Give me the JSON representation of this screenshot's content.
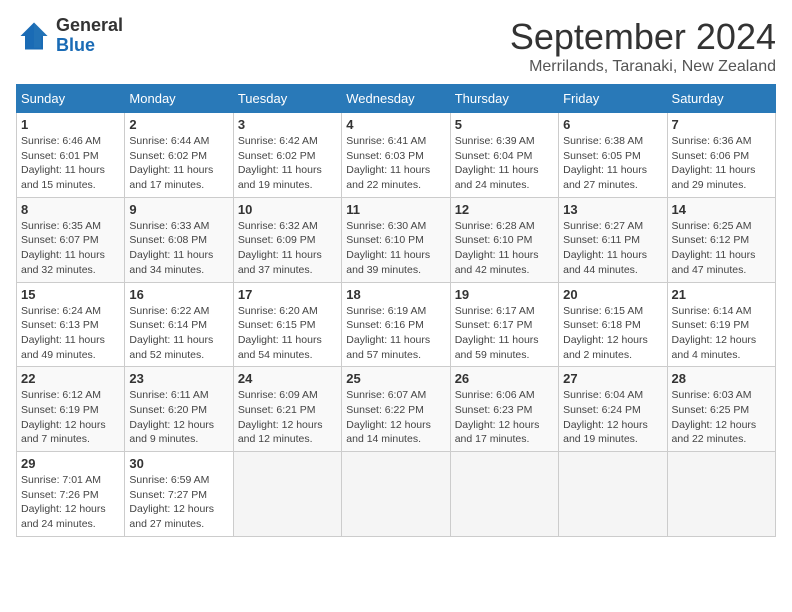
{
  "logo": {
    "general": "General",
    "blue": "Blue"
  },
  "header": {
    "month": "September 2024",
    "location": "Merrilands, Taranaki, New Zealand"
  },
  "weekdays": [
    "Sunday",
    "Monday",
    "Tuesday",
    "Wednesday",
    "Thursday",
    "Friday",
    "Saturday"
  ],
  "weeks": [
    [
      {
        "day": "1",
        "info": "Sunrise: 6:46 AM\nSunset: 6:01 PM\nDaylight: 11 hours\nand 15 minutes."
      },
      {
        "day": "2",
        "info": "Sunrise: 6:44 AM\nSunset: 6:02 PM\nDaylight: 11 hours\nand 17 minutes."
      },
      {
        "day": "3",
        "info": "Sunrise: 6:42 AM\nSunset: 6:02 PM\nDaylight: 11 hours\nand 19 minutes."
      },
      {
        "day": "4",
        "info": "Sunrise: 6:41 AM\nSunset: 6:03 PM\nDaylight: 11 hours\nand 22 minutes."
      },
      {
        "day": "5",
        "info": "Sunrise: 6:39 AM\nSunset: 6:04 PM\nDaylight: 11 hours\nand 24 minutes."
      },
      {
        "day": "6",
        "info": "Sunrise: 6:38 AM\nSunset: 6:05 PM\nDaylight: 11 hours\nand 27 minutes."
      },
      {
        "day": "7",
        "info": "Sunrise: 6:36 AM\nSunset: 6:06 PM\nDaylight: 11 hours\nand 29 minutes."
      }
    ],
    [
      {
        "day": "8",
        "info": "Sunrise: 6:35 AM\nSunset: 6:07 PM\nDaylight: 11 hours\nand 32 minutes."
      },
      {
        "day": "9",
        "info": "Sunrise: 6:33 AM\nSunset: 6:08 PM\nDaylight: 11 hours\nand 34 minutes."
      },
      {
        "day": "10",
        "info": "Sunrise: 6:32 AM\nSunset: 6:09 PM\nDaylight: 11 hours\nand 37 minutes."
      },
      {
        "day": "11",
        "info": "Sunrise: 6:30 AM\nSunset: 6:10 PM\nDaylight: 11 hours\nand 39 minutes."
      },
      {
        "day": "12",
        "info": "Sunrise: 6:28 AM\nSunset: 6:10 PM\nDaylight: 11 hours\nand 42 minutes."
      },
      {
        "day": "13",
        "info": "Sunrise: 6:27 AM\nSunset: 6:11 PM\nDaylight: 11 hours\nand 44 minutes."
      },
      {
        "day": "14",
        "info": "Sunrise: 6:25 AM\nSunset: 6:12 PM\nDaylight: 11 hours\nand 47 minutes."
      }
    ],
    [
      {
        "day": "15",
        "info": "Sunrise: 6:24 AM\nSunset: 6:13 PM\nDaylight: 11 hours\nand 49 minutes."
      },
      {
        "day": "16",
        "info": "Sunrise: 6:22 AM\nSunset: 6:14 PM\nDaylight: 11 hours\nand 52 minutes."
      },
      {
        "day": "17",
        "info": "Sunrise: 6:20 AM\nSunset: 6:15 PM\nDaylight: 11 hours\nand 54 minutes."
      },
      {
        "day": "18",
        "info": "Sunrise: 6:19 AM\nSunset: 6:16 PM\nDaylight: 11 hours\nand 57 minutes."
      },
      {
        "day": "19",
        "info": "Sunrise: 6:17 AM\nSunset: 6:17 PM\nDaylight: 11 hours\nand 59 minutes."
      },
      {
        "day": "20",
        "info": "Sunrise: 6:15 AM\nSunset: 6:18 PM\nDaylight: 12 hours\nand 2 minutes."
      },
      {
        "day": "21",
        "info": "Sunrise: 6:14 AM\nSunset: 6:19 PM\nDaylight: 12 hours\nand 4 minutes."
      }
    ],
    [
      {
        "day": "22",
        "info": "Sunrise: 6:12 AM\nSunset: 6:19 PM\nDaylight: 12 hours\nand 7 minutes."
      },
      {
        "day": "23",
        "info": "Sunrise: 6:11 AM\nSunset: 6:20 PM\nDaylight: 12 hours\nand 9 minutes."
      },
      {
        "day": "24",
        "info": "Sunrise: 6:09 AM\nSunset: 6:21 PM\nDaylight: 12 hours\nand 12 minutes."
      },
      {
        "day": "25",
        "info": "Sunrise: 6:07 AM\nSunset: 6:22 PM\nDaylight: 12 hours\nand 14 minutes."
      },
      {
        "day": "26",
        "info": "Sunrise: 6:06 AM\nSunset: 6:23 PM\nDaylight: 12 hours\nand 17 minutes."
      },
      {
        "day": "27",
        "info": "Sunrise: 6:04 AM\nSunset: 6:24 PM\nDaylight: 12 hours\nand 19 minutes."
      },
      {
        "day": "28",
        "info": "Sunrise: 6:03 AM\nSunset: 6:25 PM\nDaylight: 12 hours\nand 22 minutes."
      }
    ],
    [
      {
        "day": "29",
        "info": "Sunrise: 7:01 AM\nSunset: 7:26 PM\nDaylight: 12 hours\nand 24 minutes."
      },
      {
        "day": "30",
        "info": "Sunrise: 6:59 AM\nSunset: 7:27 PM\nDaylight: 12 hours\nand 27 minutes."
      },
      {
        "day": "",
        "info": ""
      },
      {
        "day": "",
        "info": ""
      },
      {
        "day": "",
        "info": ""
      },
      {
        "day": "",
        "info": ""
      },
      {
        "day": "",
        "info": ""
      }
    ]
  ]
}
